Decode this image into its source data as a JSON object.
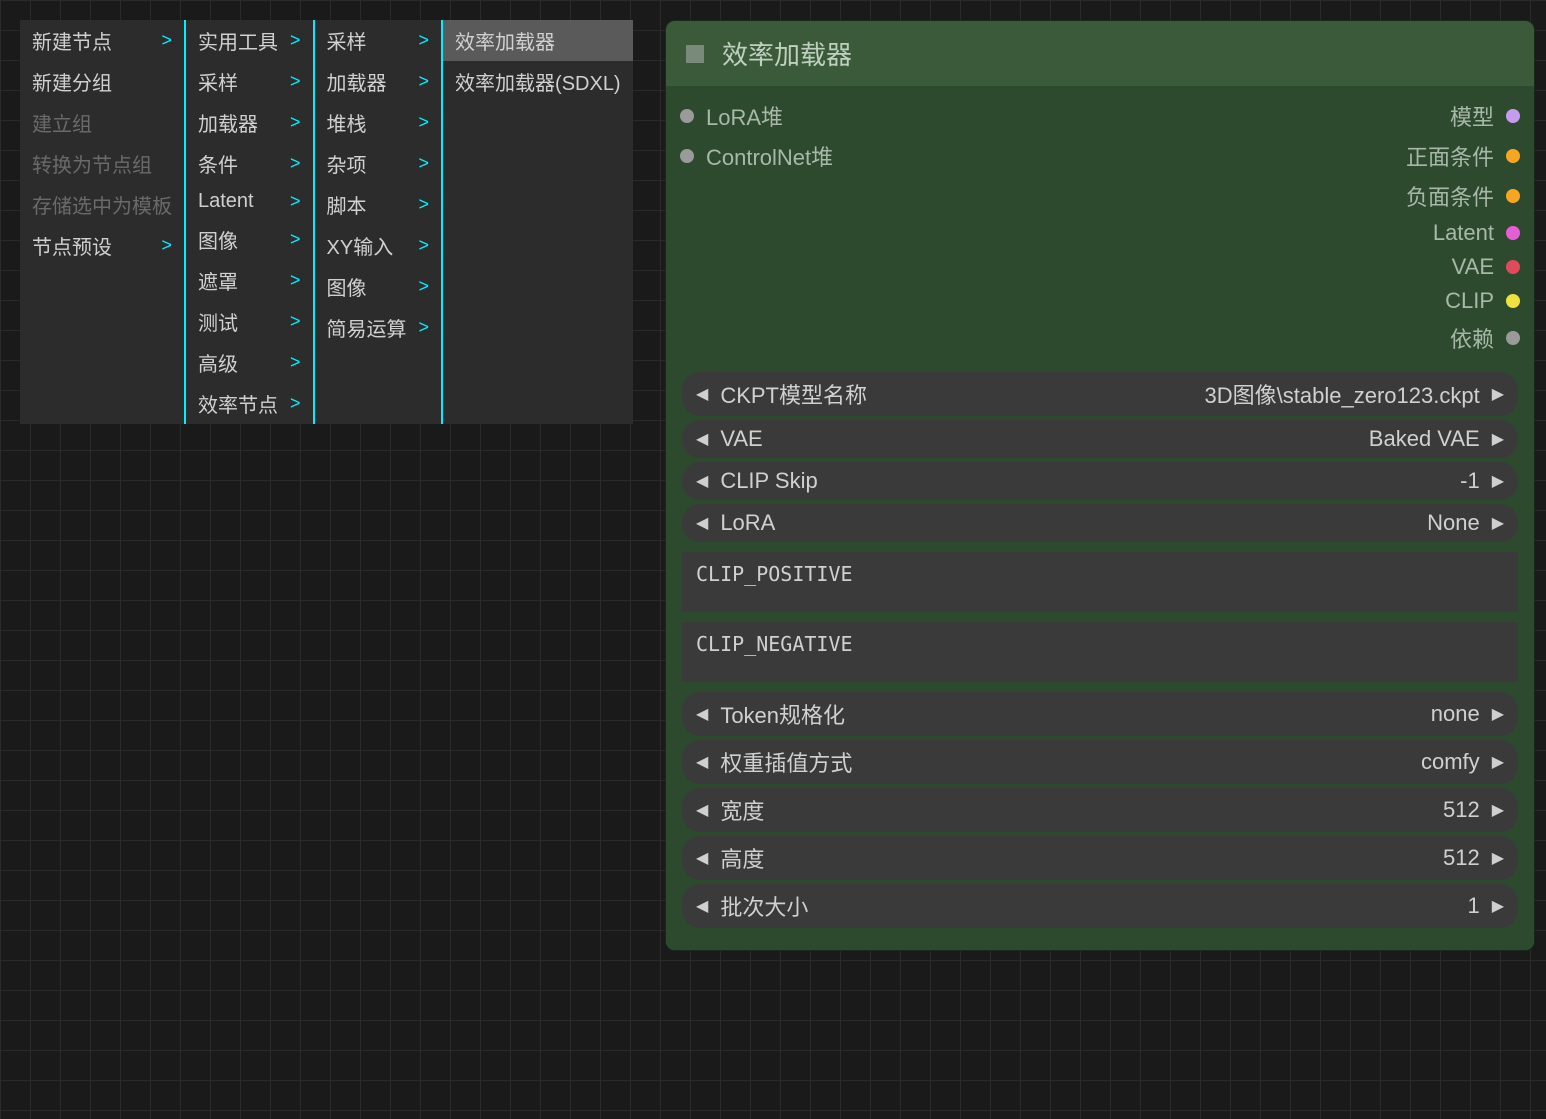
{
  "contextMenu": {
    "col1": [
      {
        "label": "新建节点",
        "arrow": true,
        "disabled": false
      },
      {
        "label": "新建分组",
        "arrow": false,
        "disabled": false
      },
      {
        "label": "建立组",
        "arrow": false,
        "disabled": true
      },
      {
        "label": "转换为节点组",
        "arrow": false,
        "disabled": true
      },
      {
        "label": "存储选中为模板",
        "arrow": false,
        "disabled": true
      },
      {
        "label": "节点预设",
        "arrow": true,
        "disabled": false
      }
    ],
    "col2": [
      {
        "label": "实用工具",
        "arrow": true
      },
      {
        "label": "采样",
        "arrow": true
      },
      {
        "label": "加载器",
        "arrow": true
      },
      {
        "label": "条件",
        "arrow": true
      },
      {
        "label": "Latent",
        "arrow": true
      },
      {
        "label": "图像",
        "arrow": true
      },
      {
        "label": "遮罩",
        "arrow": true
      },
      {
        "label": "测试",
        "arrow": true
      },
      {
        "label": "高级",
        "arrow": true
      },
      {
        "label": "效率节点",
        "arrow": true
      }
    ],
    "col3": [
      {
        "label": "采样",
        "arrow": true
      },
      {
        "label": "加载器",
        "arrow": true
      },
      {
        "label": "堆栈",
        "arrow": true
      },
      {
        "label": "杂项",
        "arrow": true
      },
      {
        "label": "脚本",
        "arrow": true
      },
      {
        "label": "XY输入",
        "arrow": true
      },
      {
        "label": "图像",
        "arrow": true
      },
      {
        "label": "简易运算",
        "arrow": true
      }
    ],
    "col4": [
      {
        "label": "效率加载器",
        "highlight": true
      },
      {
        "label": "效率加载器(SDXL)",
        "highlight": false
      }
    ]
  },
  "node": {
    "title": "效率加载器",
    "inputs": [
      {
        "label": "LoRA堆",
        "color": "#9a9a9a"
      },
      {
        "label": "ControlNet堆",
        "color": "#9a9a9a"
      }
    ],
    "outputs": [
      {
        "label": "模型",
        "color": "#c69aed"
      },
      {
        "label": "正面条件",
        "color": "#f5a623"
      },
      {
        "label": "负面条件",
        "color": "#f5a623"
      },
      {
        "label": "Latent",
        "color": "#e65dd6"
      },
      {
        "label": "VAE",
        "color": "#e04a5a"
      },
      {
        "label": "CLIP",
        "color": "#f0e040"
      },
      {
        "label": "依赖",
        "color": "#9a9a9a"
      }
    ],
    "widgets1": [
      {
        "label": "CKPT模型名称",
        "value": "3D图像\\stable_zero123.ckpt"
      },
      {
        "label": "VAE",
        "value": "Baked VAE"
      },
      {
        "label": "CLIP Skip",
        "value": "-1"
      },
      {
        "label": "LoRA",
        "value": "None"
      }
    ],
    "text1": "CLIP_POSITIVE",
    "text2": "CLIP_NEGATIVE",
    "widgets2": [
      {
        "label": "Token规格化",
        "value": "none"
      },
      {
        "label": "权重插值方式",
        "value": "comfy"
      },
      {
        "label": "宽度",
        "value": "512"
      },
      {
        "label": "高度",
        "value": "512"
      },
      {
        "label": "批次大小",
        "value": "1"
      }
    ]
  }
}
